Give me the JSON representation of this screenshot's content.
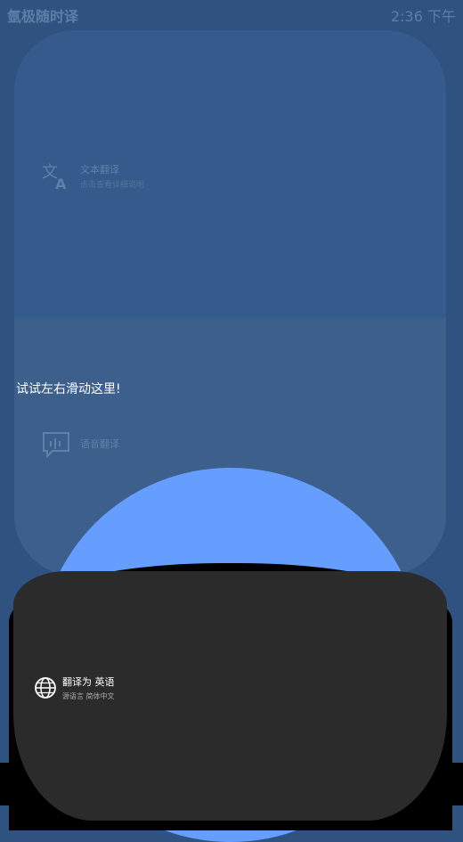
{
  "status": {
    "app_title": "氩极随时译",
    "time": "2:36 下午"
  },
  "features": [
    {
      "label": "文本翻译",
      "sub": "点击查看详细说明",
      "icon": "translate-icon"
    },
    {
      "label": "语音翻译",
      "sub": "",
      "icon": "voice-chat-icon"
    }
  ],
  "hint": "试试左右滑动这里!",
  "target": {
    "title": "翻译为 英语",
    "source": "源语言 简体中文",
    "icon": "globe-icon"
  },
  "colors": {
    "background": "#2f5280",
    "dome": "#669eff",
    "panel": "#2b2b2b"
  }
}
